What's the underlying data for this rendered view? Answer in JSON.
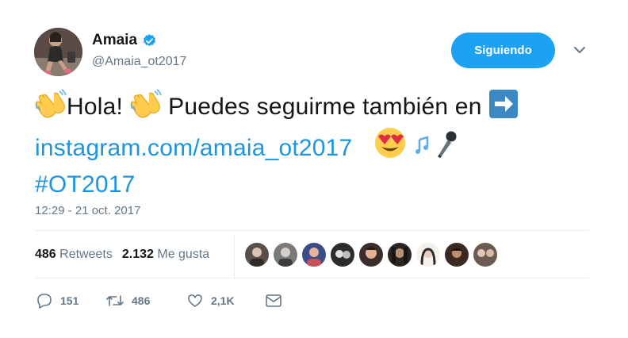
{
  "user": {
    "name": "Amaia",
    "handle": "@Amaia_ot2017",
    "verified_icon": "verified-badge-icon",
    "avatar_colors": [
      "#5b4a45",
      "#c9a08a",
      "#e56a7b"
    ]
  },
  "follow_button": {
    "label": "Siguiendo",
    "color": "#1da1f2"
  },
  "tweet": {
    "text_part1": "Hola!",
    "text_part2": "Puedes seguirme también en",
    "link_text": "instagram.com/amaia_ot2017",
    "hashtag": "#OT2017",
    "emojis": [
      "waving-hands",
      "waving-hands",
      "right-arrow",
      "heart-eyes",
      "music-notes",
      "microphone"
    ],
    "link_color": "#1b95e0"
  },
  "timestamp": "12:29 - 21 oct. 2017",
  "stats": {
    "retweets_count": "486",
    "retweets_label": "Retweets",
    "likes_count": "2.132",
    "likes_label": "Me gusta"
  },
  "likers": [
    {
      "colors": [
        "#5a4f48",
        "#d8c2b1"
      ]
    },
    {
      "colors": [
        "#7a7a7a",
        "#d6d0c8"
      ]
    },
    {
      "colors": [
        "#3a4d86",
        "#e7b3a1"
      ]
    },
    {
      "colors": [
        "#2c2c2c",
        "#e0e0e0"
      ]
    },
    {
      "colors": [
        "#3b2e2a",
        "#e3b394"
      ]
    },
    {
      "colors": [
        "#2b2524",
        "#b68f78"
      ]
    },
    {
      "colors": [
        "#2b2a2a",
        "#e6cfc1"
      ]
    },
    {
      "colors": [
        "#3c2a22",
        "#ba8f70"
      ]
    },
    {
      "colors": [
        "#6c5b52",
        "#e4c7b6"
      ]
    }
  ],
  "actions": {
    "reply_count": "151",
    "retweet_count": "486",
    "like_count": "2,1K",
    "icons": [
      "reply-icon",
      "retweet-icon",
      "like-icon",
      "message-icon"
    ]
  }
}
